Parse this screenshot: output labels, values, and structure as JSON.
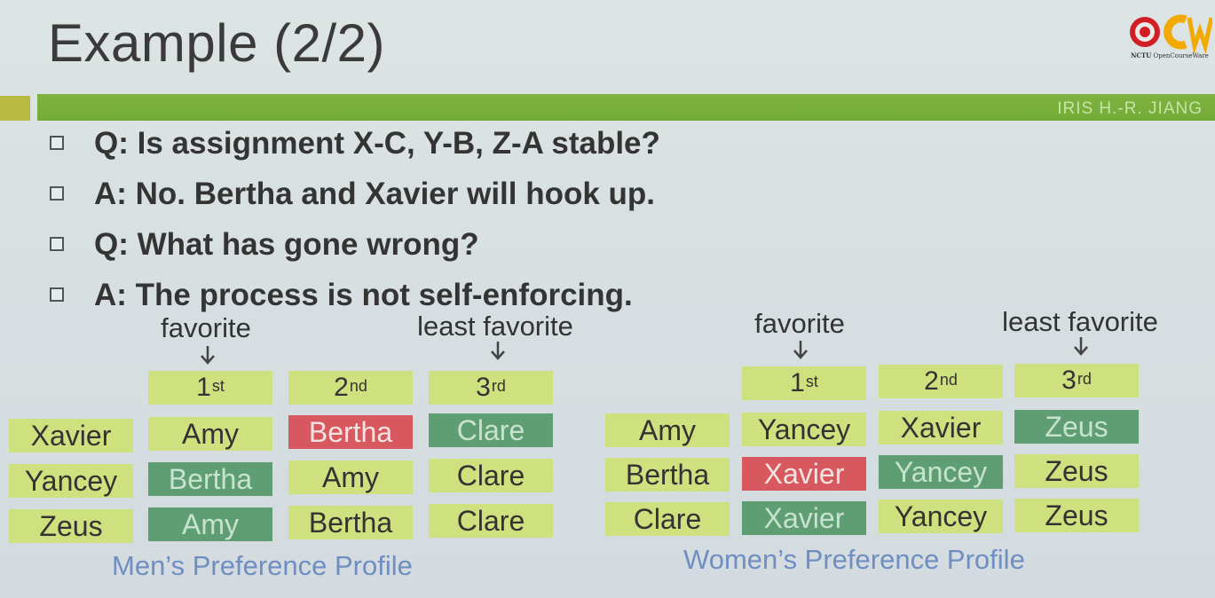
{
  "slide": {
    "title": "Example (2/2)",
    "logo_caption_bold": "NCTU",
    "logo_caption_rest": " OpenCourseWare",
    "author": "IRIS H.-R. JIANG",
    "bullets": [
      "Q:  Is assignment X-C, Y-B, Z-A stable?",
      "A:  No. Bertha and Xavier will hook up.",
      "Q: What has gone wrong?",
      "A: The process is not self-enforcing."
    ]
  },
  "colors": {
    "bar_green": "#78ae3b",
    "cell_yellow": "#cfe07e",
    "cell_red": "#d7595f",
    "cell_green": "#5f9e73",
    "caption_blue": "#6f8ec2"
  },
  "men": {
    "favorite_label": "favorite",
    "least_label": "least favorite",
    "headers": [
      {
        "num": "1",
        "suffix": "st"
      },
      {
        "num": "2",
        "suffix": "nd"
      },
      {
        "num": "3",
        "suffix": "rd"
      }
    ],
    "rows": [
      {
        "name": "Xavier",
        "prefs": [
          {
            "text": "Amy",
            "hl": "none"
          },
          {
            "text": "Bertha",
            "hl": "red"
          },
          {
            "text": "Clare",
            "hl": "green"
          }
        ]
      },
      {
        "name": "Yancey",
        "prefs": [
          {
            "text": "Bertha",
            "hl": "green"
          },
          {
            "text": "Amy",
            "hl": "none"
          },
          {
            "text": "Clare",
            "hl": "none"
          }
        ]
      },
      {
        "name": "Zeus",
        "prefs": [
          {
            "text": "Amy",
            "hl": "green"
          },
          {
            "text": "Bertha",
            "hl": "none"
          },
          {
            "text": "Clare",
            "hl": "none"
          }
        ]
      }
    ],
    "caption": "Men’s Preference Profile"
  },
  "women": {
    "favorite_label": "favorite",
    "least_label": "least favorite",
    "headers": [
      {
        "num": "1",
        "suffix": "st"
      },
      {
        "num": "2",
        "suffix": "nd"
      },
      {
        "num": "3",
        "suffix": "rd"
      }
    ],
    "rows": [
      {
        "name": "Amy",
        "prefs": [
          {
            "text": "Yancey",
            "hl": "none"
          },
          {
            "text": "Xavier",
            "hl": "none"
          },
          {
            "text": "Zeus",
            "hl": "green"
          }
        ]
      },
      {
        "name": "Bertha",
        "prefs": [
          {
            "text": "Xavier",
            "hl": "red"
          },
          {
            "text": "Yancey",
            "hl": "green"
          },
          {
            "text": "Zeus",
            "hl": "none"
          }
        ]
      },
      {
        "name": "Clare",
        "prefs": [
          {
            "text": "Xavier",
            "hl": "green"
          },
          {
            "text": "Yancey",
            "hl": "none"
          },
          {
            "text": "Zeus",
            "hl": "none"
          }
        ]
      }
    ],
    "caption": "Women’s Preference Profile"
  }
}
